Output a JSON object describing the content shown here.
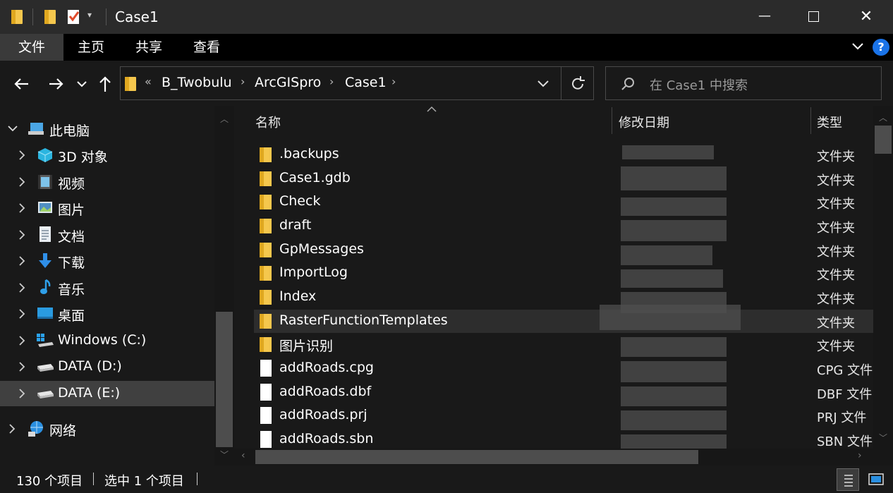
{
  "window": {
    "title": "Case1",
    "controls": {
      "minimize": "—",
      "maximize": "☐",
      "close": "✕"
    }
  },
  "ribbon": {
    "tabs": [
      {
        "label": "文件",
        "active": true
      },
      {
        "label": "主页"
      },
      {
        "label": "共享"
      },
      {
        "label": "查看"
      }
    ],
    "help": "?"
  },
  "address": {
    "overflow": "«",
    "crumbs": [
      "B_Twobulu",
      "ArcGISpro",
      "Case1"
    ],
    "search_placeholder": "在 Case1 中搜索"
  },
  "nav": {
    "items": [
      {
        "label": "此电脑",
        "icon": "computer-icon",
        "level": 0,
        "expanded": true
      },
      {
        "label": "3D 对象",
        "icon": "cube-icon",
        "level": 1
      },
      {
        "label": "视频",
        "icon": "video-icon",
        "level": 1
      },
      {
        "label": "图片",
        "icon": "picture-icon",
        "level": 1
      },
      {
        "label": "文档",
        "icon": "document-icon",
        "level": 1
      },
      {
        "label": "下载",
        "icon": "download-icon",
        "level": 1
      },
      {
        "label": "音乐",
        "icon": "music-icon",
        "level": 1
      },
      {
        "label": "桌面",
        "icon": "desktop-icon",
        "level": 1
      },
      {
        "label": "Windows (C:)",
        "icon": "windows-drive-icon",
        "level": 1
      },
      {
        "label": "DATA (D:)",
        "icon": "drive-icon",
        "level": 1
      },
      {
        "label": "DATA (E:)",
        "icon": "drive-icon",
        "level": 1,
        "selected": true
      },
      {
        "label": "网络",
        "icon": "network-icon",
        "level": 0
      }
    ]
  },
  "columns": {
    "name": "名称",
    "modified": "修改日期",
    "type": "类型"
  },
  "files": [
    {
      "name": ".backups",
      "type": "文件夹",
      "kind": "folder"
    },
    {
      "name": "Case1.gdb",
      "type": "文件夹",
      "kind": "folder"
    },
    {
      "name": "Check",
      "type": "文件夹",
      "kind": "folder"
    },
    {
      "name": "draft",
      "type": "文件夹",
      "kind": "folder"
    },
    {
      "name": "GpMessages",
      "type": "文件夹",
      "kind": "folder"
    },
    {
      "name": "ImportLog",
      "type": "文件夹",
      "kind": "folder"
    },
    {
      "name": "Index",
      "type": "文件夹",
      "kind": "folder"
    },
    {
      "name": "RasterFunctionTemplates",
      "type": "文件夹",
      "kind": "folder",
      "hover": true
    },
    {
      "name": "图片识别",
      "type": "文件夹",
      "kind": "folder"
    },
    {
      "name": "addRoads.cpg",
      "type": "CPG 文件",
      "kind": "file"
    },
    {
      "name": "addRoads.dbf",
      "type": "DBF 文件",
      "kind": "file"
    },
    {
      "name": "addRoads.prj",
      "type": "PRJ 文件",
      "kind": "file"
    },
    {
      "name": "addRoads.sbn",
      "type": "SBN 文件",
      "kind": "file"
    }
  ],
  "status": {
    "count": "130 个项目",
    "selected": "选中 1 个项目"
  }
}
